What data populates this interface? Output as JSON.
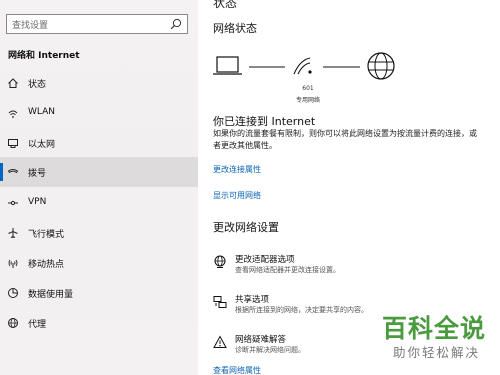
{
  "sidebar": {
    "search_placeholder": "查找设置",
    "section_title": "网络和 Internet",
    "items": [
      {
        "label": "状态",
        "icon": "home-icon"
      },
      {
        "label": "WLAN",
        "icon": "wifi-icon"
      },
      {
        "label": "以太网",
        "icon": "ethernet-icon"
      },
      {
        "label": "拨号",
        "icon": "dialup-icon",
        "active": true
      },
      {
        "label": "VPN",
        "icon": "vpn-icon"
      },
      {
        "label": "飞行模式",
        "icon": "airplane-icon"
      },
      {
        "label": "移动热点",
        "icon": "hotspot-icon"
      },
      {
        "label": "数据使用量",
        "icon": "data-usage-icon"
      },
      {
        "label": "代理",
        "icon": "globe-icon"
      }
    ]
  },
  "main": {
    "page_title_partial": "状态",
    "network_status_heading": "网络状态",
    "network_name": "601",
    "network_type": "专用网络",
    "status_title": "你已连接到 Internet",
    "status_description": "如果你的流量套餐有限制，则你可以将此网络设置为按流量计费的连接，或者更改其他属性。",
    "link_change_properties": "更改连接属性",
    "link_show_networks": "显示可用网络",
    "change_settings_heading": "更改网络设置",
    "options": [
      {
        "title": "更改适配器选项",
        "desc": "查看网络适配器并更改连接设置。"
      },
      {
        "title": "共享选项",
        "desc": "根据所连接到的网络，决定要共享的内容。"
      },
      {
        "title": "网络疑难解答",
        "desc": "诊断并解决网络问题。"
      }
    ],
    "link_view_properties": "查看网络属性"
  },
  "watermark": {
    "main": "百科全说",
    "sub": "助你轻松解决"
  },
  "colors": {
    "accent": "#0067c0",
    "link": "#0b63b6",
    "watermark_green": "#4a9a3f"
  }
}
